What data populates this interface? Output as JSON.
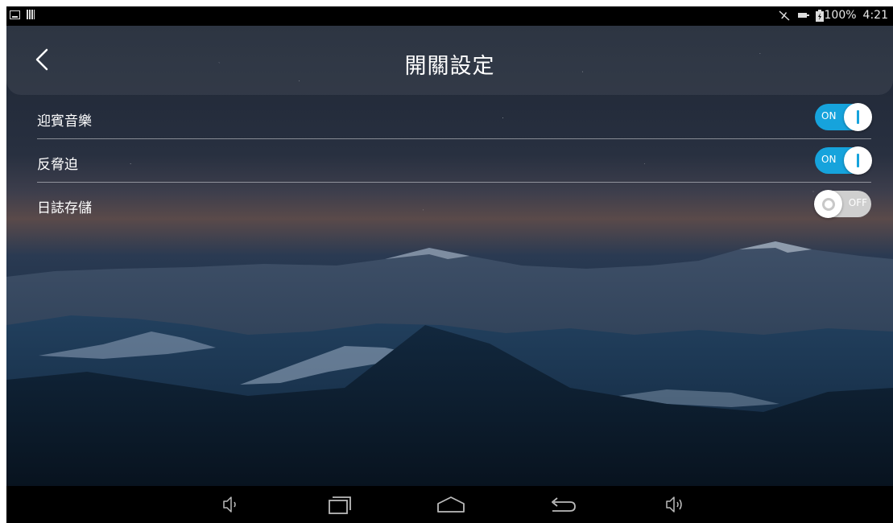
{
  "status_bar": {
    "left_icons": [
      "image-icon",
      "barcode-icon"
    ],
    "right_icons": [
      "mute-icon",
      "ethernet-icon",
      "battery-icon"
    ],
    "battery": "100%",
    "time": "4:21"
  },
  "header": {
    "title": "開關設定",
    "back_icon": "chevron-left-icon"
  },
  "settings": [
    {
      "label": "迎賓音樂",
      "state": "ON",
      "on": true
    },
    {
      "label": "反脅迫",
      "state": "ON",
      "on": true
    },
    {
      "label": "日誌存儲",
      "state": "OFF",
      "on": false
    }
  ],
  "nav_bar": {
    "buttons": [
      "volume-down-icon",
      "recent-apps-icon",
      "home-icon",
      "back-icon",
      "volume-up-icon"
    ]
  },
  "colors": {
    "toggle_on": "#16a3dc",
    "toggle_off": "#cfcfcf"
  }
}
